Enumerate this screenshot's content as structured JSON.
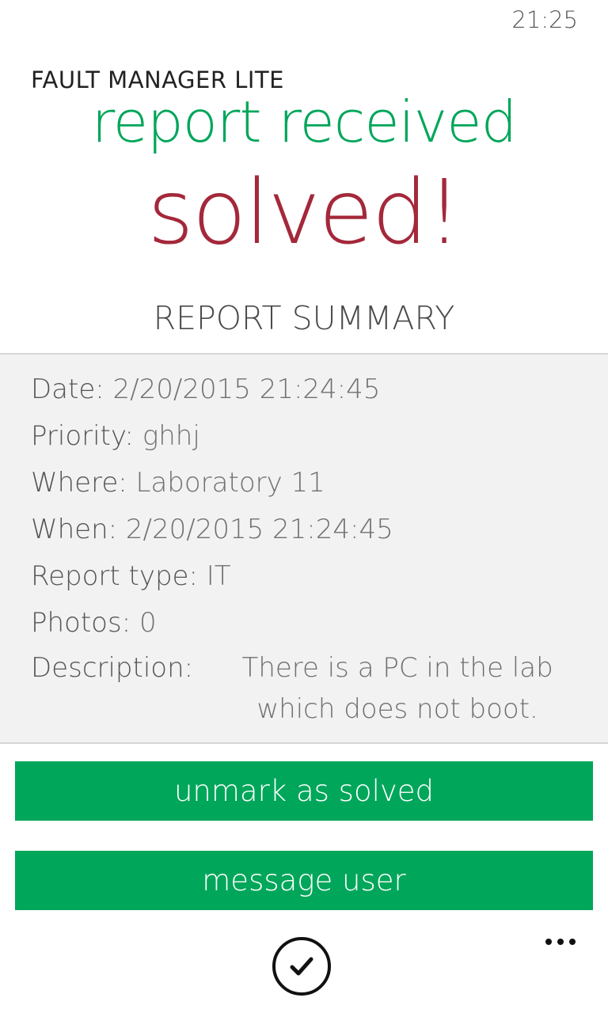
{
  "status_bar": {
    "time": "21:25"
  },
  "app": {
    "title": "FAULT MANAGER LITE",
    "page_title": "report received",
    "status": "solved!"
  },
  "summary": {
    "heading": "REPORT SUMMARY",
    "fields": [
      {
        "label": "Date:",
        "value": "2/20/2015 21:24:45"
      },
      {
        "label": "Priority:",
        "value": "ghhj"
      },
      {
        "label": "Where:",
        "value": "Laboratory 11"
      },
      {
        "label": "When:",
        "value": "2/20/2015 21:24:45"
      },
      {
        "label": "Report type:",
        "value": "IT"
      },
      {
        "label": "Photos:",
        "value": "0"
      }
    ],
    "description": {
      "label": "Description:",
      "value": "There is a PC in the lab which does not boot."
    }
  },
  "actions": {
    "unmark_label": "unmark as solved",
    "message_label": "message user"
  },
  "app_bar": {
    "check_icon": "check-circle-icon",
    "more_icon": "more-dots-icon"
  },
  "colors": {
    "accent_green": "#00a65a",
    "solved_red": "#a4283a",
    "panel_bg": "#f2f2f2"
  }
}
